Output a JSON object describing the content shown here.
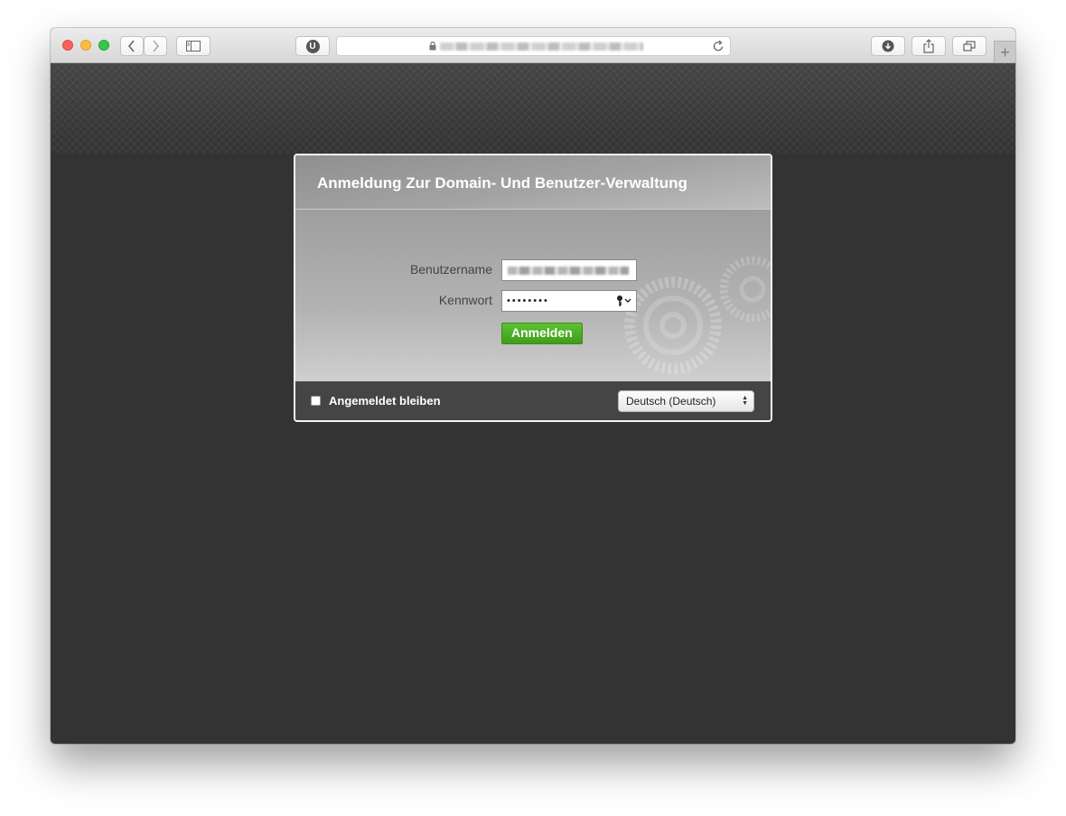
{
  "browser": {
    "address_url": "",
    "extension_badge": "U",
    "new_tab_label": "+"
  },
  "login": {
    "title": "Anmeldung Zur Domain- Und Benutzer-Verwaltung",
    "username_label": "Benutzername",
    "username_value": "",
    "password_label": "Kennwort",
    "password_mask": "••••••••",
    "submit_label": "Anmelden",
    "remember_label": "Angemeldet bleiben",
    "remember_checked": false,
    "language_selected": "Deutsch (Deutsch)"
  },
  "colors": {
    "accent_green": "#4caf25",
    "page_background": "#333333"
  }
}
